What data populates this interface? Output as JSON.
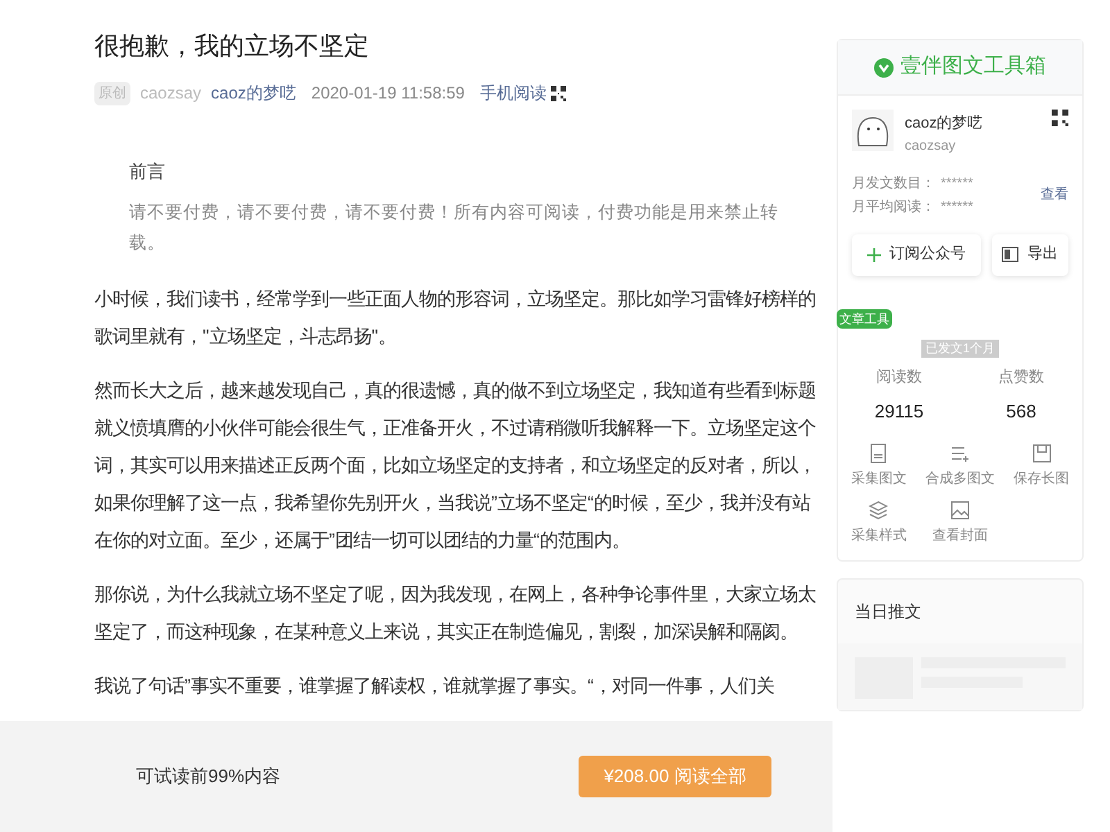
{
  "article": {
    "title": "很抱歉，我的立场不坚定",
    "meta": {
      "badge": "原创",
      "author_id": "caozsay",
      "account": "caoz的梦呓",
      "datetime": "2020-01-19 11:58:59",
      "mobile_link": "手机阅读"
    },
    "preface": {
      "heading": "前言",
      "text": "请不要付费，请不要付费，请不要付费！所有内容可阅读，付费功能是用来禁止转载。"
    },
    "paragraphs": [
      "小时候，我们读书，经常学到一些正面人物的形容词，立场坚定。那比如学习雷锋好榜样的歌词里就有，\"立场坚定，斗志昂扬\"。",
      "然而长大之后，越来越发现自己，真的很遗憾，真的做不到立场坚定，我知道有些看到标题就义愤填膺的小伙伴可能会很生气，正准备开火，不过请稍微听我解释一下。立场坚定这个词，其实可以用来描述正反两个面，比如立场坚定的支持者，和立场坚定的反对者，所以，如果你理解了这一点，我希望你先别开火，当我说”立场不坚定“的时候，至少，我并没有站在你的对立面。至少，还属于”团结一切可以团结的力量“的范围内。",
      "那你说，为什么我就立场不坚定了呢，因为我发现，在网上，各种争论事件里，大家立场太坚定了，而这种现象，在某种意义上来说，其实正在制造偏见，割裂，加深误解和隔阂。",
      "我说了句话”事实不重要，谁掌握了解读权，谁就掌握了事实。“，对同一件事，人们关"
    ]
  },
  "paywall": {
    "note": "可试读前99%内容",
    "button": "¥208.00 阅读全部"
  },
  "sidebar": {
    "title": "壹伴图文工具箱",
    "profile": {
      "name": "caoz的梦呓",
      "id": "caozsay"
    },
    "stats": [
      {
        "label": "月发文数目：",
        "value": "******"
      },
      {
        "label": "月平均阅读：",
        "value": "******"
      }
    ],
    "view_link": "查看",
    "buttons": [
      {
        "kind": "add",
        "label": "订阅公众号"
      },
      {
        "kind": "export",
        "label": "导出"
      }
    ],
    "tools_tag": "文章工具",
    "age_badge": "已发文1个月",
    "metrics": [
      {
        "label": "阅读数",
        "value": "29115"
      },
      {
        "label": "点赞数",
        "value": "568"
      }
    ],
    "tools": [
      {
        "kind": "doc",
        "label": "采集图文"
      },
      {
        "kind": "list",
        "label": "合成多图文"
      },
      {
        "kind": "save",
        "label": "保存长图"
      },
      {
        "kind": "layers",
        "label": "采集样式"
      },
      {
        "kind": "image",
        "label": "查看封面"
      }
    ],
    "daily_title": "当日推文"
  }
}
